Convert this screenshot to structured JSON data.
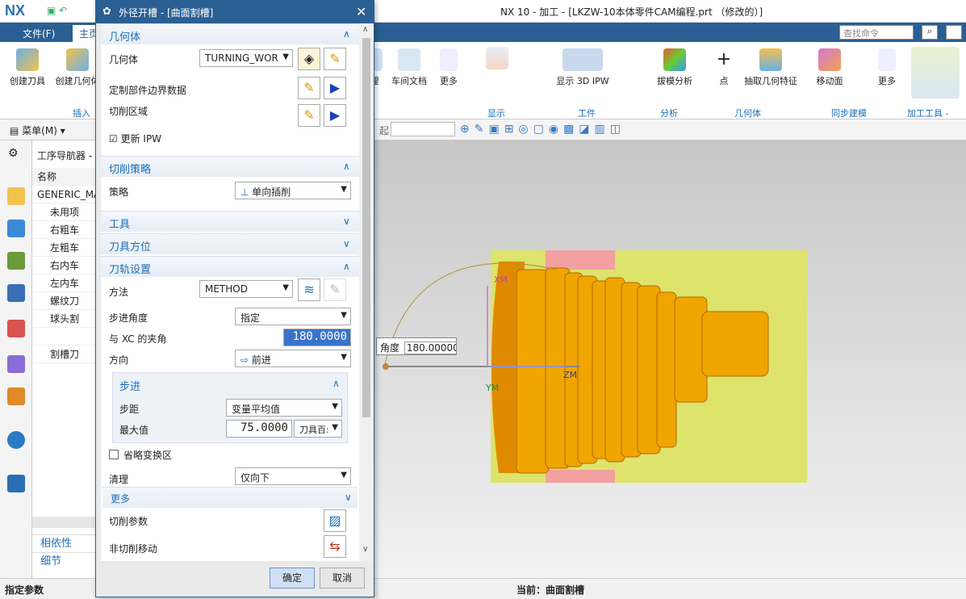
{
  "app": {
    "logo": "NX",
    "title": "NX 10 - 加工 - [LKZW-10本体零件CAM编程.prt （修改的）]"
  },
  "ribbon_tabs": [
    {
      "label": "文件(F)"
    },
    {
      "label": "主页"
    }
  ],
  "search": {
    "placeholder": "查找命令"
  },
  "ribbon": {
    "left_buttons": [
      {
        "label": "创建刀具"
      },
      {
        "label": "创建几何体"
      }
    ],
    "insert_group": "插入",
    "right_buttons": [
      {
        "label": "理"
      },
      {
        "label": "车间文档"
      },
      {
        "label": "更多"
      },
      {
        "label": "显示 3D IPW"
      },
      {
        "label": "拔模分析"
      },
      {
        "label": "点"
      },
      {
        "label": "抽取几何特征"
      },
      {
        "label": "移动面"
      },
      {
        "label": "更多"
      }
    ],
    "groups": [
      {
        "label": "显示"
      },
      {
        "label": "工件"
      },
      {
        "label": "分析"
      },
      {
        "label": "几何体"
      },
      {
        "label": "同步建模"
      },
      {
        "label": "加工工具 - G..."
      }
    ]
  },
  "menubar": {
    "menu_label": "菜单(M)",
    "filter_label": "起"
  },
  "navigator": {
    "title": "工序导航器 - ",
    "column": "名称",
    "rows": [
      {
        "label": "GENERIC_MA"
      },
      {
        "label": "未用项"
      },
      {
        "label": "右粗车"
      },
      {
        "label": "左粗车"
      },
      {
        "label": "右内车"
      },
      {
        "label": "左内车"
      },
      {
        "label": "螺纹刀"
      },
      {
        "label": "球头割"
      },
      {
        "label": ""
      },
      {
        "label": "割槽刀"
      }
    ],
    "bottom": [
      {
        "label": "相依性"
      },
      {
        "label": "细节"
      }
    ]
  },
  "dialog": {
    "title": "外径开槽 - [曲面割槽]",
    "geometry": {
      "header": "几何体",
      "geom_label": "几何体",
      "geom_value": "TURNING_WOR",
      "boundary_label": "定制部件边界数据",
      "region_label": "切削区域",
      "update_ipw_label": "更新 IPW",
      "update_ipw_checked": "☑"
    },
    "strategy": {
      "header": "切削策略",
      "label": "策略",
      "value": "单向插削"
    },
    "tool": {
      "header": "工具"
    },
    "tool_axis": {
      "header": "刀具方位"
    },
    "path": {
      "header": "刀轨设置",
      "method_label": "方法",
      "method_value": "METHOD",
      "step_angle_label": "步进角度",
      "step_angle_value": "指定",
      "xc_angle_label": "与 XC 的夹角",
      "xc_angle_value": "180.0000",
      "direction_label": "方向",
      "direction_value": "前进",
      "stepover": {
        "header": "步进",
        "step_label": "步距",
        "step_value": "变量平均值",
        "max_label": "最大值",
        "max_value": "75.0000",
        "max_unit": "刀具百:"
      },
      "skip_label": "省略变换区",
      "cleanup_label": "清理",
      "cleanup_value": "仅向下",
      "more_header": "更多"
    },
    "cut_params_label": "切削参数",
    "noncut_label": "非切削移动",
    "ok": "确定",
    "cancel": "取消"
  },
  "viewport": {
    "angle_label": "角度",
    "angle_value": "180.00000",
    "axis_xm": "XM",
    "axis_ym": "YM",
    "axis_zm": "ZM"
  },
  "status": {
    "left": "指定参数",
    "current": "当前：曲面割槽"
  },
  "colors": {
    "accent": "#2a5f93",
    "part": "#f0a500",
    "stock": "#dde36b",
    "groove": "#f3a0a0"
  }
}
